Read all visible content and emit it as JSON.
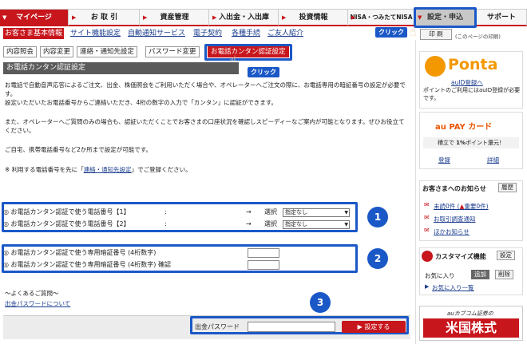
{
  "topnav": {
    "items": [
      "マイページ",
      "お 取 引",
      "資産管理",
      "入出金・入出庫",
      "投資情報",
      "NISA・つみたてNISA",
      "設定・申込",
      "サポート"
    ]
  },
  "subnav": {
    "items": [
      "お客さま基本情報",
      "サイト機能設定",
      "自動通知サービス",
      "電子契約",
      "各種手続",
      "ご友人紹介"
    ]
  },
  "tabs": {
    "items": [
      "内容照会",
      "内容変更",
      "連絡・通知先設定",
      "パスワード変更",
      "お電話カンタン認証設定"
    ]
  },
  "callouts": {
    "click1": "クリック",
    "click2": "クリック"
  },
  "print_label": "印 刷",
  "print_note": "(このページの印刷)",
  "main": {
    "title": "お電話カンタン認証設定",
    "para1": "お電話で自動音声応答によるご注文、出金、株価照会をご利用いただく場合や、オペレーターへご注文の際に、お電話専用の暗証番号の設定が必要です。",
    "para1b": "設定いただいたお電話番号からご連絡いただき、4桁の数字の入力で「カンタン」に認証ができます。",
    "para2": "また、オペレーターへご質問のみの場合も、認証いただくことでお客さまの口座状況を確認しスピーディーなご案内が可能となります。ぜひお役立てください。",
    "para3": "ご自宅、携帯電話番号など2か所まで設定が可能です。",
    "para4_pre": "※ 利用する電話番号を先に「",
    "para4_link": "連絡・通知先設定",
    "para4_post": "」でご登録ください。",
    "phone1_label": "◎ お電話カンタン認証で使う電話番号【1】",
    "phone2_label": "◎ お電話カンタン認証で使う電話番号【2】",
    "colon": ":",
    "arrow": "→",
    "select_label": "選択",
    "select_value": "指定なし",
    "pin_label": "◎ お電話カンタン認証で使う専用暗証番号 (4桁数字)",
    "pin_confirm_label": "◎ お電話カンタン認証で使う専用暗証番号 (4桁数字) 確認",
    "faq_heading": "～よくあるご質問～",
    "faq_link": "出金パスワードについて",
    "password_label": "出金パスワード",
    "submit_label": "設定する",
    "badges": [
      "1",
      "2",
      "3"
    ]
  },
  "sidebar": {
    "ponta_logo": "Ponta",
    "auid_link": "auID登録へ",
    "ponta_note": "ポイントのご利用にはauID登録が必要です。",
    "aupay_logo": "au PAY カード",
    "aupay_note_pre": "積立で",
    "aupay_note_rate": "1%",
    "aupay_note_post": "ポイント還元！",
    "aupay_links": [
      "登録",
      "詳細"
    ],
    "notice_title": "お客さまへのお知らせ",
    "history_button": "履歴",
    "notice_links": [
      "未読0件 (",
      "重要0件)",
      "お取引調査通知",
      "ほかお知らせ"
    ],
    "customize_title": "カスタマイズ機能",
    "setting_button": "設定",
    "fav_label": "お気に入り",
    "add_button": "追加",
    "delete_button": "削除",
    "fav_list_link": "お気に入り一覧",
    "banner_top": "auカブコム証券の",
    "banner_main": "米国株式"
  },
  "colors": {
    "brand_red": "#c8161d",
    "highlight_blue": "#1b58c7",
    "ponta_orange": "#f39800"
  }
}
